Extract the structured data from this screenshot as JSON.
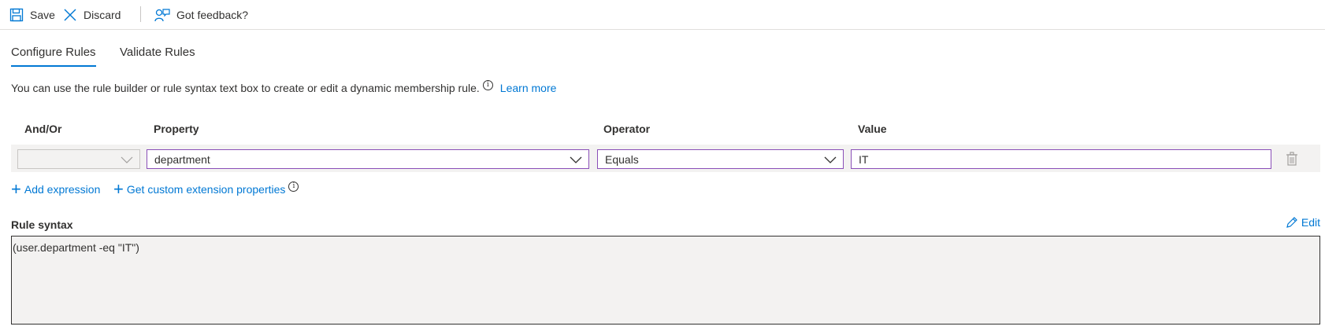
{
  "toolbar": {
    "save_label": "Save",
    "discard_label": "Discard",
    "feedback_label": "Got feedback?"
  },
  "tabs": [
    {
      "label": "Configure Rules",
      "active": true
    },
    {
      "label": "Validate Rules",
      "active": false
    }
  ],
  "description": {
    "text": "You can use the rule builder or rule syntax text box to create or edit a dynamic membership rule.",
    "learn_more": "Learn more"
  },
  "columns": {
    "andor": "And/Or",
    "property": "Property",
    "operator": "Operator",
    "value": "Value"
  },
  "rule": {
    "andor": "",
    "property": "department",
    "operator": "Equals",
    "value": "IT"
  },
  "actions": {
    "add_expression": "Add expression",
    "custom_extension": "Get custom extension properties"
  },
  "syntax": {
    "title": "Rule syntax",
    "edit_label": "Edit",
    "text": "(user.department -eq \"IT\")"
  },
  "colors": {
    "accent": "#0078d4",
    "focus_border": "#8a4fb8",
    "row_bg": "#f3f2f1"
  },
  "icons": [
    "save-icon",
    "discard-icon",
    "feedback-icon",
    "info-icon",
    "chevron-down-icon",
    "trash-icon",
    "plus-icon",
    "pencil-icon"
  ]
}
